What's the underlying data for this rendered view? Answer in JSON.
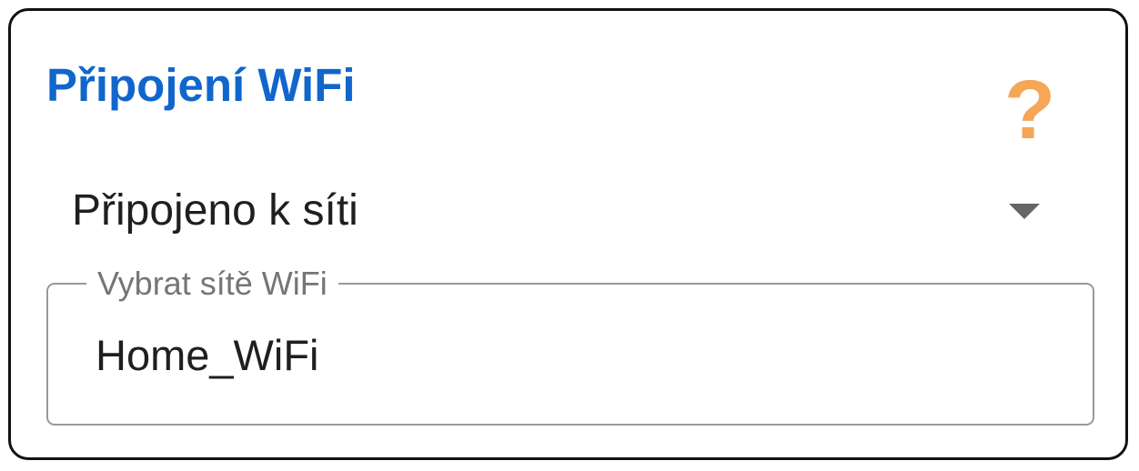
{
  "wifi_card": {
    "title": "Připojení WiFi",
    "help_icon_glyph": "?",
    "status": {
      "value": "Připojeno k síti"
    },
    "network_field": {
      "label": "Vybrat sítě WiFi",
      "value": "Home_WiFi"
    }
  },
  "icons": {
    "help": "question-mark-icon",
    "dropdown": "triangle-down-icon"
  },
  "colors": {
    "title": "#1166cc",
    "help_icon": "#f5a656",
    "text": "#1f1f1f",
    "label": "#757575",
    "border": "#111111",
    "field_border": "#999999",
    "arrow": "#666666"
  }
}
